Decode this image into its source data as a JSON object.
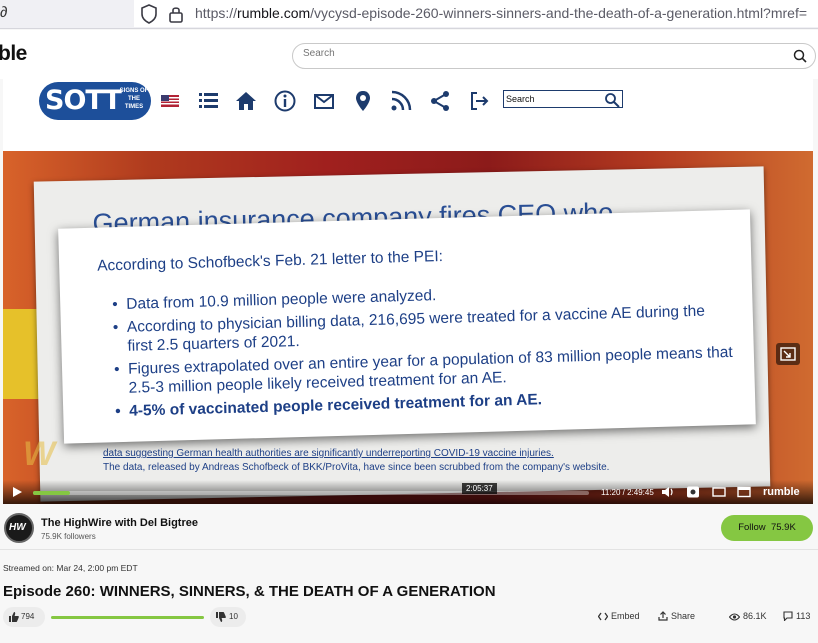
{
  "browser": {
    "left_edge_glyph": "∂",
    "url_prefix": "https://",
    "url_domain": "rumble.com",
    "url_path": "/vycysd-episode-260-winners-sinners-and-the-death-of-a-generation.html?mref="
  },
  "header": {
    "logo_partial": "ble",
    "search_placeholder": "Search"
  },
  "sott": {
    "logo_text": "SOTT",
    "logo_sub": "SIGNS OF THE TIMES",
    "search_label": "Search"
  },
  "video_frame": {
    "back_headline": "German insurance company fires CEO who",
    "title_line": "According to Schofbeck's Feb. 21 letter to the PEI:",
    "items": [
      "Data from 10.9 million people were analyzed.",
      "According to physician billing data, 216,695 were treated for a vaccine AE during the first 2.5 quarters of 2021.",
      "Figures extrapolated over an entire year for a population of 83 million people means that 2.5-3 million people likely received treatment for an AE.",
      "4-5% of vaccinated people received treatment for an AE."
    ],
    "bottom_line_1": "data suggesting German health authorities are significantly underreporting COVID-19 vaccine injuries.",
    "bottom_line_2": "The data, released by Andreas Schofbeck of BKK/ProVita, have since been scrubbed from the company's website."
  },
  "player": {
    "hover_time": "2:05:37",
    "time_display": "11:20 / 2:49:45",
    "brand": "rumble",
    "progress_fraction": 0.067
  },
  "channel": {
    "avatar_text": "HW",
    "name": "The HighWire with Del Bigtree",
    "followers": "75.9K followers",
    "follow_label": "Follow",
    "follow_count": "75.9K"
  },
  "video": {
    "streamed": "Streamed on: Mar 24, 2:00 pm EDT",
    "title": "Episode 260: WINNERS, SINNERS, & THE DEATH OF A GENERATION",
    "upvotes": "794",
    "downvotes": "10",
    "embed_label": "Embed",
    "share_label": "Share",
    "views": "86.1K",
    "comments": "113"
  },
  "colors": {
    "accent_green": "#85c742",
    "sott_blue": "#1d4f9a",
    "slide_text": "#1d3f86"
  }
}
